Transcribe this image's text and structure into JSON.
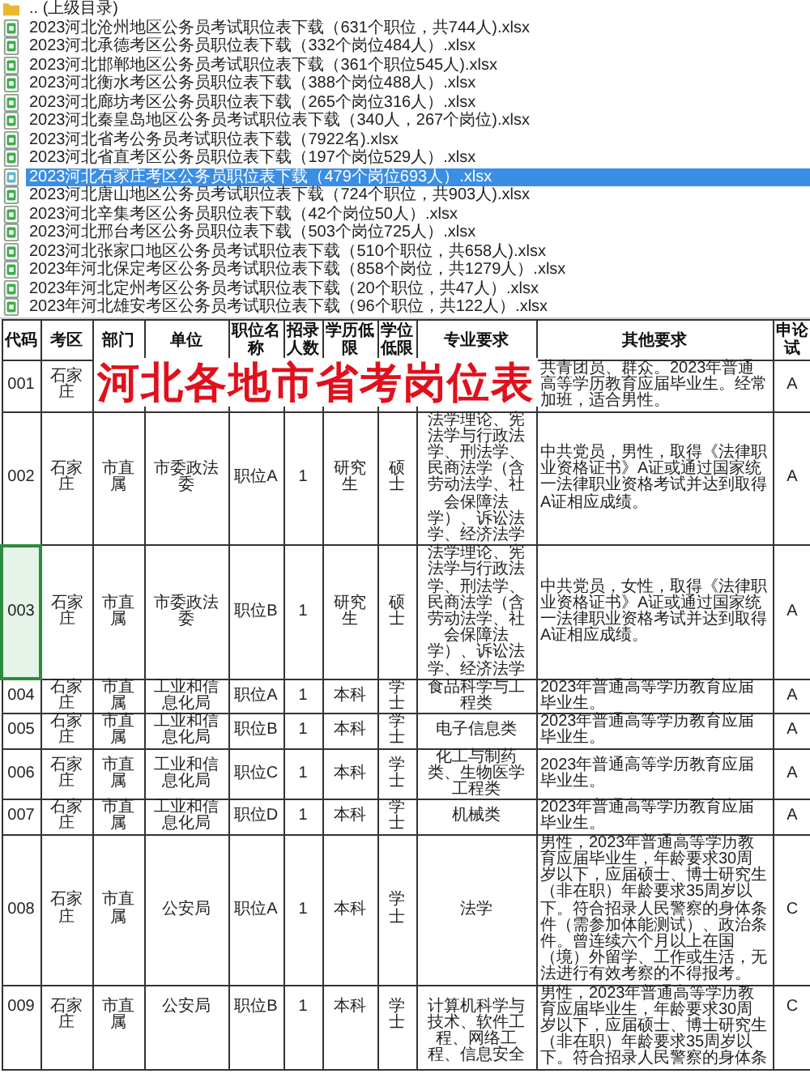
{
  "file_list": {
    "parent": ".. (上级目录)",
    "files": [
      {
        "name": "2023河北沧州地区公务员考试职位表下载（631个职位，共744人).xlsx",
        "selected": false
      },
      {
        "name": "2023河北承德考区公务员职位表下载（332个岗位484人）.xlsx",
        "selected": false
      },
      {
        "name": "2023河北邯郸地区公务员考试职位表下载（361个职位545人).xlsx",
        "selected": false
      },
      {
        "name": "2023河北衡水考区公务员职位表下载（388个岗位488人）.xlsx",
        "selected": false
      },
      {
        "name": "2023河北廊坊考区公务员职位表下载（265个岗位316人）.xlsx",
        "selected": false
      },
      {
        "name": "2023河北秦皇岛地区公务员考试职位表下载（340人，267个岗位).xlsx",
        "selected": false
      },
      {
        "name": "2023河北省考公务员考试职位表下载（7922名).xlsx",
        "selected": false
      },
      {
        "name": "2023河北省直考区公务员职位表下载（197个岗位529人）.xlsx",
        "selected": false
      },
      {
        "name": "2023河北石家庄考区公务员职位表下载（479个岗位693人）.xlsx",
        "selected": true
      },
      {
        "name": "2023河北唐山地区公务员考试职位表下载（724个职位，共903人).xlsx",
        "selected": false
      },
      {
        "name": "2023河北辛集考区公务员职位表下载（42个岗位50人）.xlsx",
        "selected": false
      },
      {
        "name": "2023河北邢台考区公务员职位表下载（503个岗位725人）.xlsx",
        "selected": false
      },
      {
        "name": "2023河北张家口地区公务员考试职位表下载（510个职位，共658人).xlsx",
        "selected": false
      },
      {
        "name": "2023年河北保定考区公务员考试职位表下载（858个岗位，共1279人）.xlsx",
        "selected": false
      },
      {
        "name": "2023年河北定州考区公务员考试职位表下载（20个职位，共47人）.xlsx",
        "selected": false
      },
      {
        "name": "2023年河北雄安考区公务员考试职位表下载（96个职位，共122人）.xlsx",
        "selected": false
      }
    ]
  },
  "overlay_title": "河北各地市省考岗位表",
  "table": {
    "columns": [
      "代码",
      "考区",
      "部门",
      "单位",
      "职位名称",
      "招录人数",
      "学历低限",
      "学位低限",
      "专业要求",
      "其他要求",
      "申论试"
    ],
    "rows": [
      {
        "selected": false,
        "cells": [
          "001",
          "石家庄",
          null,
          null,
          null,
          null,
          null,
          null,
          null,
          "共青团员、群众。2023年普通高等学历教育应届毕业生。经常加班，适合男性。",
          "A"
        ]
      },
      {
        "selected": false,
        "cells": [
          "002",
          "石家庄",
          "市直属",
          "市委政法委",
          "职位A",
          "1",
          "研究生",
          "硕士",
          "法学理论、宪法学与行政法学、刑法学、民商法学（含劳动法学、社会保障法学）、诉讼法学、经济法学",
          "中共党员，男性，取得《法律职业资格证书》A证或通过国家统一法律职业资格考试并达到取得A证相应成绩。",
          "A"
        ]
      },
      {
        "selected": true,
        "cells": [
          "003",
          "石家庄",
          "市直属",
          "市委政法委",
          "职位B",
          "1",
          "研究生",
          "硕士",
          "法学理论、宪法学与行政法学、刑法学、民商法学（含劳动法学、社会保障法学）、诉讼法学、经济法学",
          "中共党员，女性，取得《法律职业资格证书》A证或通过国家统一法律职业资格考试并达到取得A证相应成绩。",
          "A"
        ]
      },
      {
        "selected": false,
        "cells": [
          "004",
          "石家庄",
          "市直属",
          "工业和信息化局",
          "职位A",
          "1",
          "本科",
          "学士",
          "食品科学与工程类",
          "2023年普通高等学历教育应届毕业生。",
          "A"
        ]
      },
      {
        "selected": false,
        "cells": [
          "005",
          "石家庄",
          "市直属",
          "工业和信息化局",
          "职位B",
          "1",
          "本科",
          "学士",
          "电子信息类",
          "2023年普通高等学历教育应届毕业生。",
          "A"
        ]
      },
      {
        "selected": false,
        "cells": [
          "006",
          "石家庄",
          "市直属",
          "工业和信息化局",
          "职位C",
          "1",
          "本科",
          "学士",
          "化工与制药类、生物医学工程类",
          "2023年普通高等学历教育应届毕业生。",
          "A"
        ]
      },
      {
        "selected": false,
        "cells": [
          "007",
          "石家庄",
          "市直属",
          "工业和信息化局",
          "职位D",
          "1",
          "本科",
          "学士",
          "机械类",
          "2023年普通高等学历教育应届毕业生。",
          "A"
        ]
      },
      {
        "selected": false,
        "cells": [
          "008",
          "石家庄",
          "市直属",
          "公安局",
          "职位A",
          "1",
          "本科",
          "学士",
          "法学",
          "男性，2023年普通高等学历教育应届毕业生，年龄要求30周岁以下，应届硕士、博士研究生（非在职）年龄要求35周岁以下。符合招录人民警察的身体条件（需参加体能测试）、政治条件。曾连续六个月以上在国（境）外留学、工作或生活，无法进行有效考察的不得报考。",
          "C"
        ]
      },
      {
        "selected": false,
        "cells": [
          "009",
          "石家庄",
          "市直属",
          "公安局",
          "职位B",
          "1",
          "本科",
          "学士",
          "计算机科学与技术、软件工程、网络工程、信息安全",
          "男性，2023年普通高等学历教育应届毕业生，年龄要求30周岁以下，应届硕士、博士研究生（非在职）年龄要求35周岁以下。符合招录人民警察的身体条",
          "C"
        ]
      }
    ]
  }
}
